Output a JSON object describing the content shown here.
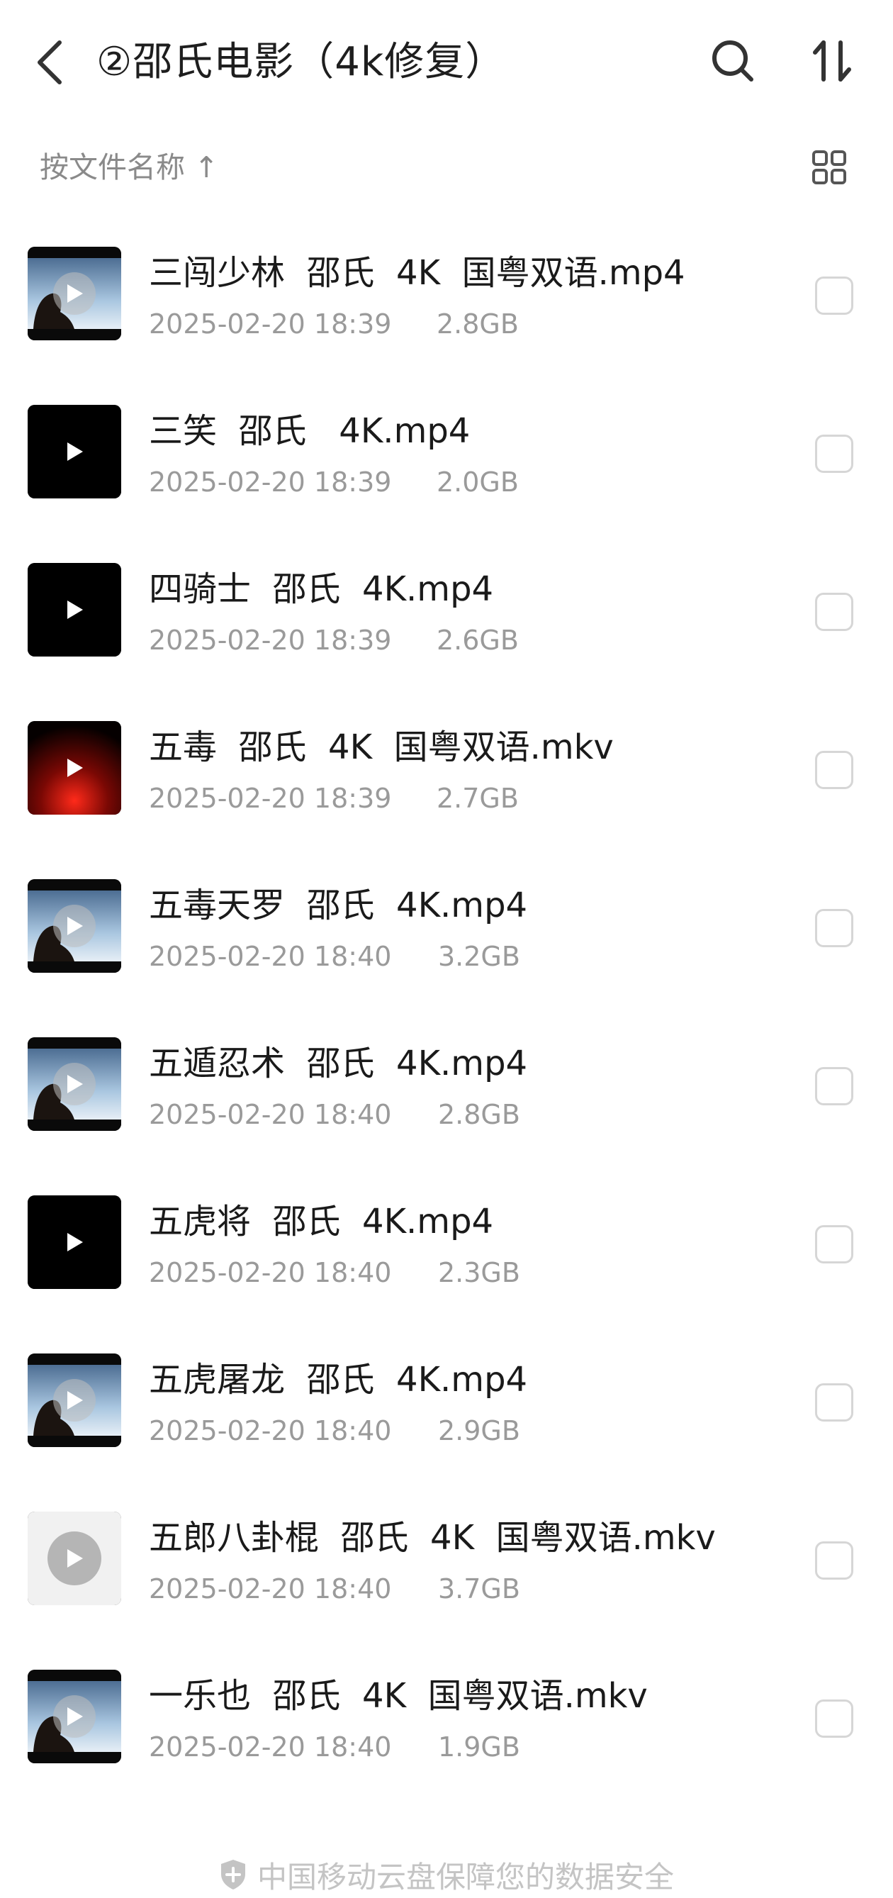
{
  "header": {
    "title": "②邵氏电影（4k修复）",
    "back_icon": "back-arrow-icon",
    "search_icon": "search-icon",
    "sort_icon": "sort-icon"
  },
  "sortbar": {
    "label": "按文件名称 ↑",
    "view_icon": "grid-view-icon"
  },
  "files": [
    {
      "name": "三闯少林  邵氏  4K  国粤双语.mp4",
      "date": "2025-02-20 18:39",
      "size": "2.8GB",
      "thumb": "photo"
    },
    {
      "name": "三笑  邵氏   4K.mp4",
      "date": "2025-02-20 18:39",
      "size": "2.0GB",
      "thumb": "black"
    },
    {
      "name": "四骑士  邵氏  4K.mp4",
      "date": "2025-02-20 18:39",
      "size": "2.6GB",
      "thumb": "black"
    },
    {
      "name": "五毒  邵氏  4K  国粤双语.mkv",
      "date": "2025-02-20 18:39",
      "size": "2.7GB",
      "thumb": "red"
    },
    {
      "name": "五毒天罗  邵氏  4K.mp4",
      "date": "2025-02-20 18:40",
      "size": "3.2GB",
      "thumb": "photo"
    },
    {
      "name": "五遁忍术  邵氏  4K.mp4",
      "date": "2025-02-20 18:40",
      "size": "2.8GB",
      "thumb": "photo"
    },
    {
      "name": "五虎将  邵氏  4K.mp4",
      "date": "2025-02-20 18:40",
      "size": "2.3GB",
      "thumb": "black"
    },
    {
      "name": "五虎屠龙  邵氏  4K.mp4",
      "date": "2025-02-20 18:40",
      "size": "2.9GB",
      "thumb": "photo"
    },
    {
      "name": "五郎八卦棍  邵氏  4K  国粤双语.mkv",
      "date": "2025-02-20 18:40",
      "size": "3.7GB",
      "thumb": "grey"
    },
    {
      "name": "一乐也  邵氏  4K  国粤双语.mkv",
      "date": "2025-02-20 18:40",
      "size": "1.9GB",
      "thumb": "photo"
    }
  ],
  "footer": {
    "text": "中国移动云盘保障您的数据安全",
    "icon": "shield-icon"
  }
}
